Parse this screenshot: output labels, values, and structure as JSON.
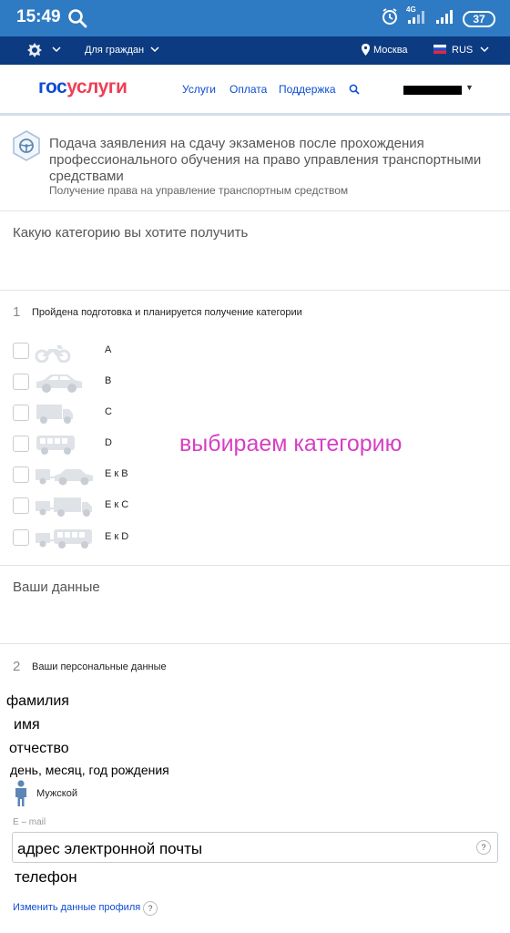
{
  "status_bar": {
    "time": "15:49",
    "network": "4G",
    "battery": "37",
    "icons": [
      "search-icon",
      "alarm-icon",
      "signal-icon",
      "battery-icon"
    ]
  },
  "gov_bar": {
    "for_citizens": "Для граждан",
    "city": "Москва",
    "language": "RUS",
    "icons": [
      "emblem-icon",
      "location-pin-icon",
      "flag-icon"
    ]
  },
  "header": {
    "logo_part1": "гос",
    "logo_part2": "услуги",
    "nav": [
      "Услуги",
      "Оплата",
      "Поддержка"
    ],
    "colors": {
      "brand_blue": "#0d4cd3",
      "brand_red": "#ee3f58",
      "gov_bar": "#0c3b82",
      "status_bar": "#2f7bc3"
    }
  },
  "service": {
    "title": "Подача заявления на сдачу экзаменов после прохождения профессионального обучения на право управления транспортными средствами",
    "subtitle": "Получение права на управление транспортным средством"
  },
  "category_section": {
    "heading": "Какую категорию вы хотите получить",
    "step_number": "1",
    "step_title": "Пройдена подготовка и планируется получение категории",
    "categories": [
      {
        "label": "A",
        "icon": "motorcycle-icon"
      },
      {
        "label": "B",
        "icon": "car-icon"
      },
      {
        "label": "C",
        "icon": "truck-icon"
      },
      {
        "label": "D",
        "icon": "bus-icon"
      },
      {
        "label": "E к B",
        "icon": "car-trailer-icon"
      },
      {
        "label": "E к C",
        "icon": "truck-trailer-icon"
      },
      {
        "label": "E к D",
        "icon": "bus-trailer-icon"
      }
    ],
    "annotation": "выбираем категорию"
  },
  "personal_section": {
    "heading": "Ваши данные",
    "step_number": "2",
    "step_title": "Ваши персональные данные",
    "annotations": {
      "surname": "фамилия",
      "name": "имя",
      "patronymic": "отчество",
      "birthdate": "день, месяц, год рождения",
      "email": "адрес электронной почты",
      "phone": "телефон"
    },
    "gender_value": "Мужской",
    "email_label": "E – mail",
    "help_mark": "?",
    "edit_profile_link": "Изменить данные профиля"
  }
}
